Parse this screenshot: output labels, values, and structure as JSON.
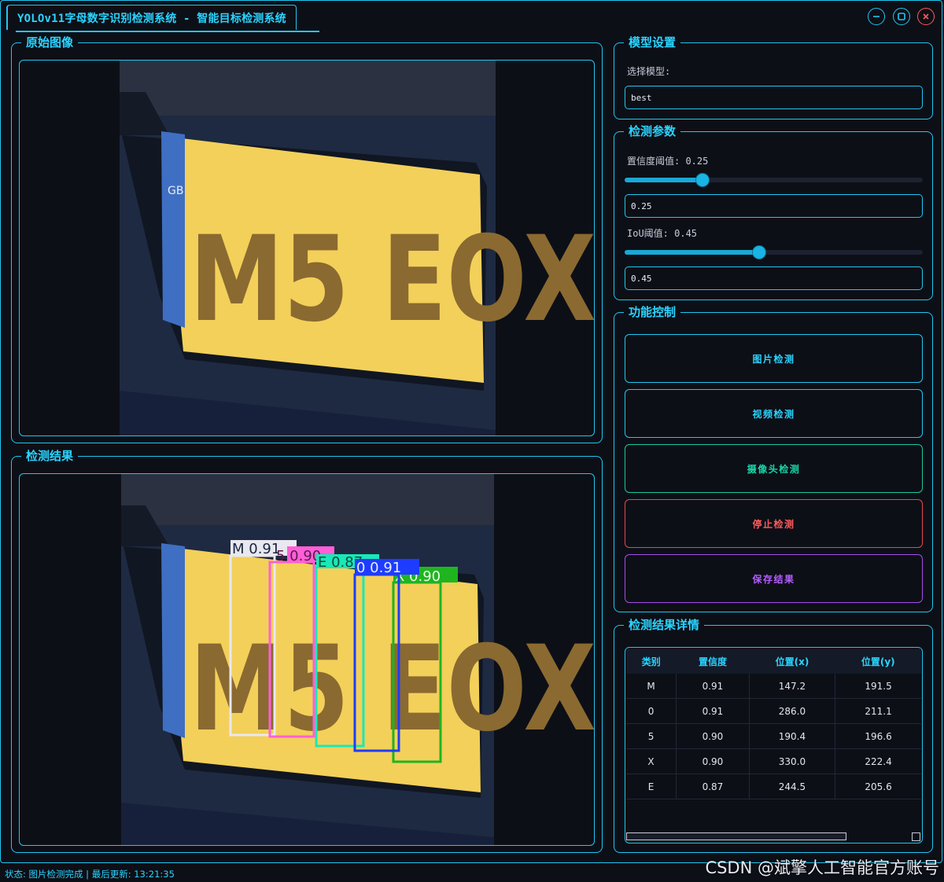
{
  "window": {
    "title": "YOLOv11字母数字识别检测系统 - 智能目标检测系统",
    "controls": [
      "minimize-icon",
      "maximize-icon",
      "close-icon"
    ],
    "accent_color": "#1ec8f0"
  },
  "original_panel": {
    "title": "原始图像",
    "plate_text": "M5 EOX"
  },
  "result_panel": {
    "title": "检测结果",
    "plate_text": "M5 EOX",
    "detections": [
      {
        "label": "M 0.91",
        "color": "#e8e8f0"
      },
      {
        "label": "5 0.90",
        "color": "#ff5fd7"
      },
      {
        "label": "E 0.87",
        "color": "#19e8b8"
      },
      {
        "label": "0 0.91",
        "color": "#1e3cff"
      },
      {
        "label": "X 0.90",
        "color": "#1fb51f"
      }
    ]
  },
  "model_settings": {
    "title": "模型设置",
    "select_label": "选择模型:",
    "selected_model": "best"
  },
  "detect_params": {
    "title": "检测参数",
    "conf_label": "置信度阈值: 0.25",
    "conf_value": 0.25,
    "conf_input": "0.25",
    "iou_label": "IoU阈值: 0.45",
    "iou_value": 0.45,
    "iou_input": "0.45"
  },
  "function_control": {
    "title": "功能控制",
    "image_detect": "图片检测",
    "video_detect": "视频检测",
    "camera_detect": "摄像头检测",
    "stop_detect": "停止检测",
    "save_result": "保存结果",
    "colors": {
      "image": "#2ad4ff",
      "video": "#2ad4ff",
      "camera": "#19d6a8",
      "stop": "#ff5b5b",
      "save": "#b45cff"
    }
  },
  "results_detail": {
    "title": "检测结果详情",
    "columns": [
      "类别",
      "置信度",
      "位置(x)",
      "位置(y)"
    ],
    "rows": [
      [
        "M",
        "0.91",
        "147.2",
        "191.5"
      ],
      [
        "0",
        "0.91",
        "286.0",
        "211.1"
      ],
      [
        "5",
        "0.90",
        "190.4",
        "196.6"
      ],
      [
        "X",
        "0.90",
        "330.0",
        "222.4"
      ],
      [
        "E",
        "0.87",
        "244.5",
        "205.6"
      ]
    ]
  },
  "status_bar": {
    "text": "状态: 图片检测完成 | 最后更新: 13:21:35"
  },
  "watermark": "CSDN @斌擎人工智能官方账号"
}
